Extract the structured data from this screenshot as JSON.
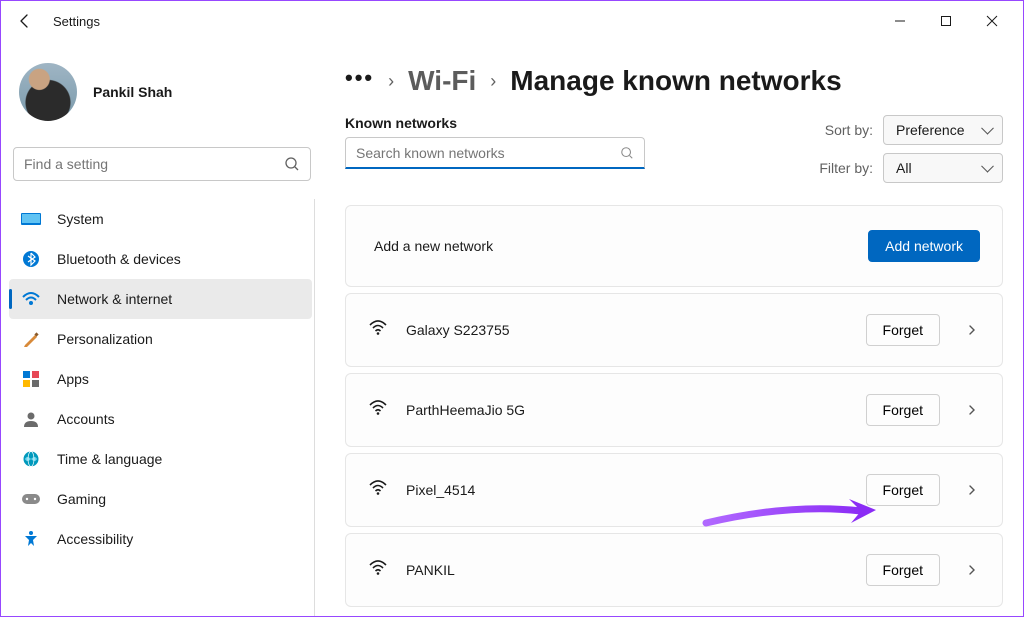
{
  "window": {
    "title": "Settings"
  },
  "user": {
    "name": "Pankil Shah"
  },
  "sidebar": {
    "search_placeholder": "Find a setting",
    "items": [
      {
        "label": "System"
      },
      {
        "label": "Bluetooth & devices"
      },
      {
        "label": "Network & internet"
      },
      {
        "label": "Personalization"
      },
      {
        "label": "Apps"
      },
      {
        "label": "Accounts"
      },
      {
        "label": "Time & language"
      },
      {
        "label": "Gaming"
      },
      {
        "label": "Accessibility"
      }
    ]
  },
  "breadcrumb": {
    "seg1": "Wi-Fi",
    "seg2": "Manage known networks"
  },
  "known": {
    "title": "Known networks",
    "search_placeholder": "Search known networks",
    "sort_label": "Sort by:",
    "sort_value": "Preference",
    "filter_label": "Filter by:",
    "filter_value": "All"
  },
  "add": {
    "title": "Add a new network",
    "button": "Add network"
  },
  "forget_label": "Forget",
  "networks": [
    {
      "name": "Galaxy S223755"
    },
    {
      "name": "ParthHeemaJio 5G"
    },
    {
      "name": "Pixel_4514"
    },
    {
      "name": "PANKIL"
    }
  ]
}
